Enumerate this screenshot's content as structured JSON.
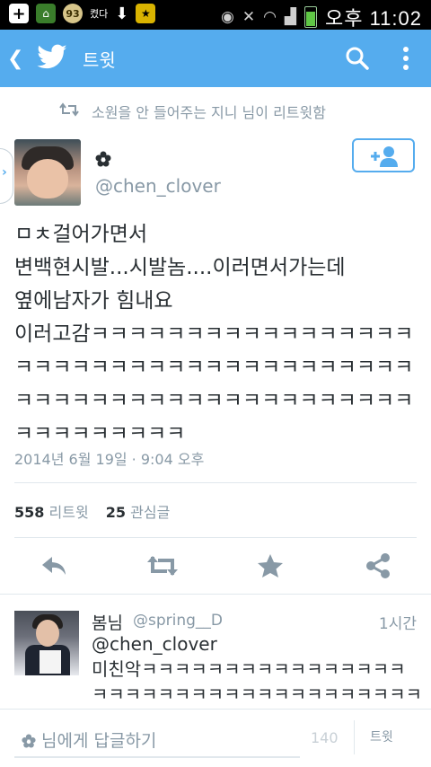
{
  "status_bar": {
    "badge": "93",
    "text": "켰다",
    "clock": "오후 11:02"
  },
  "app_bar": {
    "title": "트윗"
  },
  "retweet_notice": "소원을 안 들어주는 지니 님이 리트윗함",
  "tweet": {
    "handle": "@chen_clover",
    "text_lines": [
      "ㅁㅊ걸어가면서",
      "변백현시발...시발놈....이러면서가는데",
      "옆에남자가 힘내요",
      "이러고감ㅋㅋㅋㅋㅋㅋㅋㅋㅋㅋㅋㅋㅋㅋㅋㅋㅋ",
      "ㅋㅋㅋㅋㅋㅋㅋㅋㅋㅋㅋㅋㅋㅋㅋㅋㅋㅋㅋㅋㅋ",
      "ㅋㅋㅋㅋㅋㅋㅋㅋㅋㅋㅋㅋㅋㅋㅋㅋㅋㅋㅋㅋㅋ",
      "ㅋㅋㅋㅋㅋㅋㅋㅋㅋ"
    ],
    "timestamp": "2014년 6월 19일 · 9:04 오후",
    "retweet_count": "558",
    "retweet_label": "리트윗",
    "like_count": "25",
    "like_label": "관심글"
  },
  "reply": {
    "name": "봄님",
    "handle": "@spring__D",
    "time": "1시간",
    "text_lines": [
      "@chen_clover",
      "미친악ㅋㅋㅋㅋㅋㅋㅋㅋㅋㅋㅋㅋㅋㅋㅋㅋ",
      "ㅋㅋㅋㅋㅋㅋㅋㅋㅋㅋㅋㅋㅋㅋㅋㅋㅋㅋㅋㅋ"
    ]
  },
  "compose": {
    "placeholder": "님에게 답글하기",
    "count": "140",
    "button_label": "트윗"
  },
  "colors": {
    "brand_blue": "#55acee",
    "muted_gray": "#8899a6",
    "text": "#292f33"
  },
  "icons": [
    "back-icon",
    "twitter-bird-icon",
    "search-icon",
    "more-icon",
    "retweet-icon",
    "flower-icon",
    "follow-icon",
    "reply-icon",
    "star-icon",
    "share-icon"
  ]
}
